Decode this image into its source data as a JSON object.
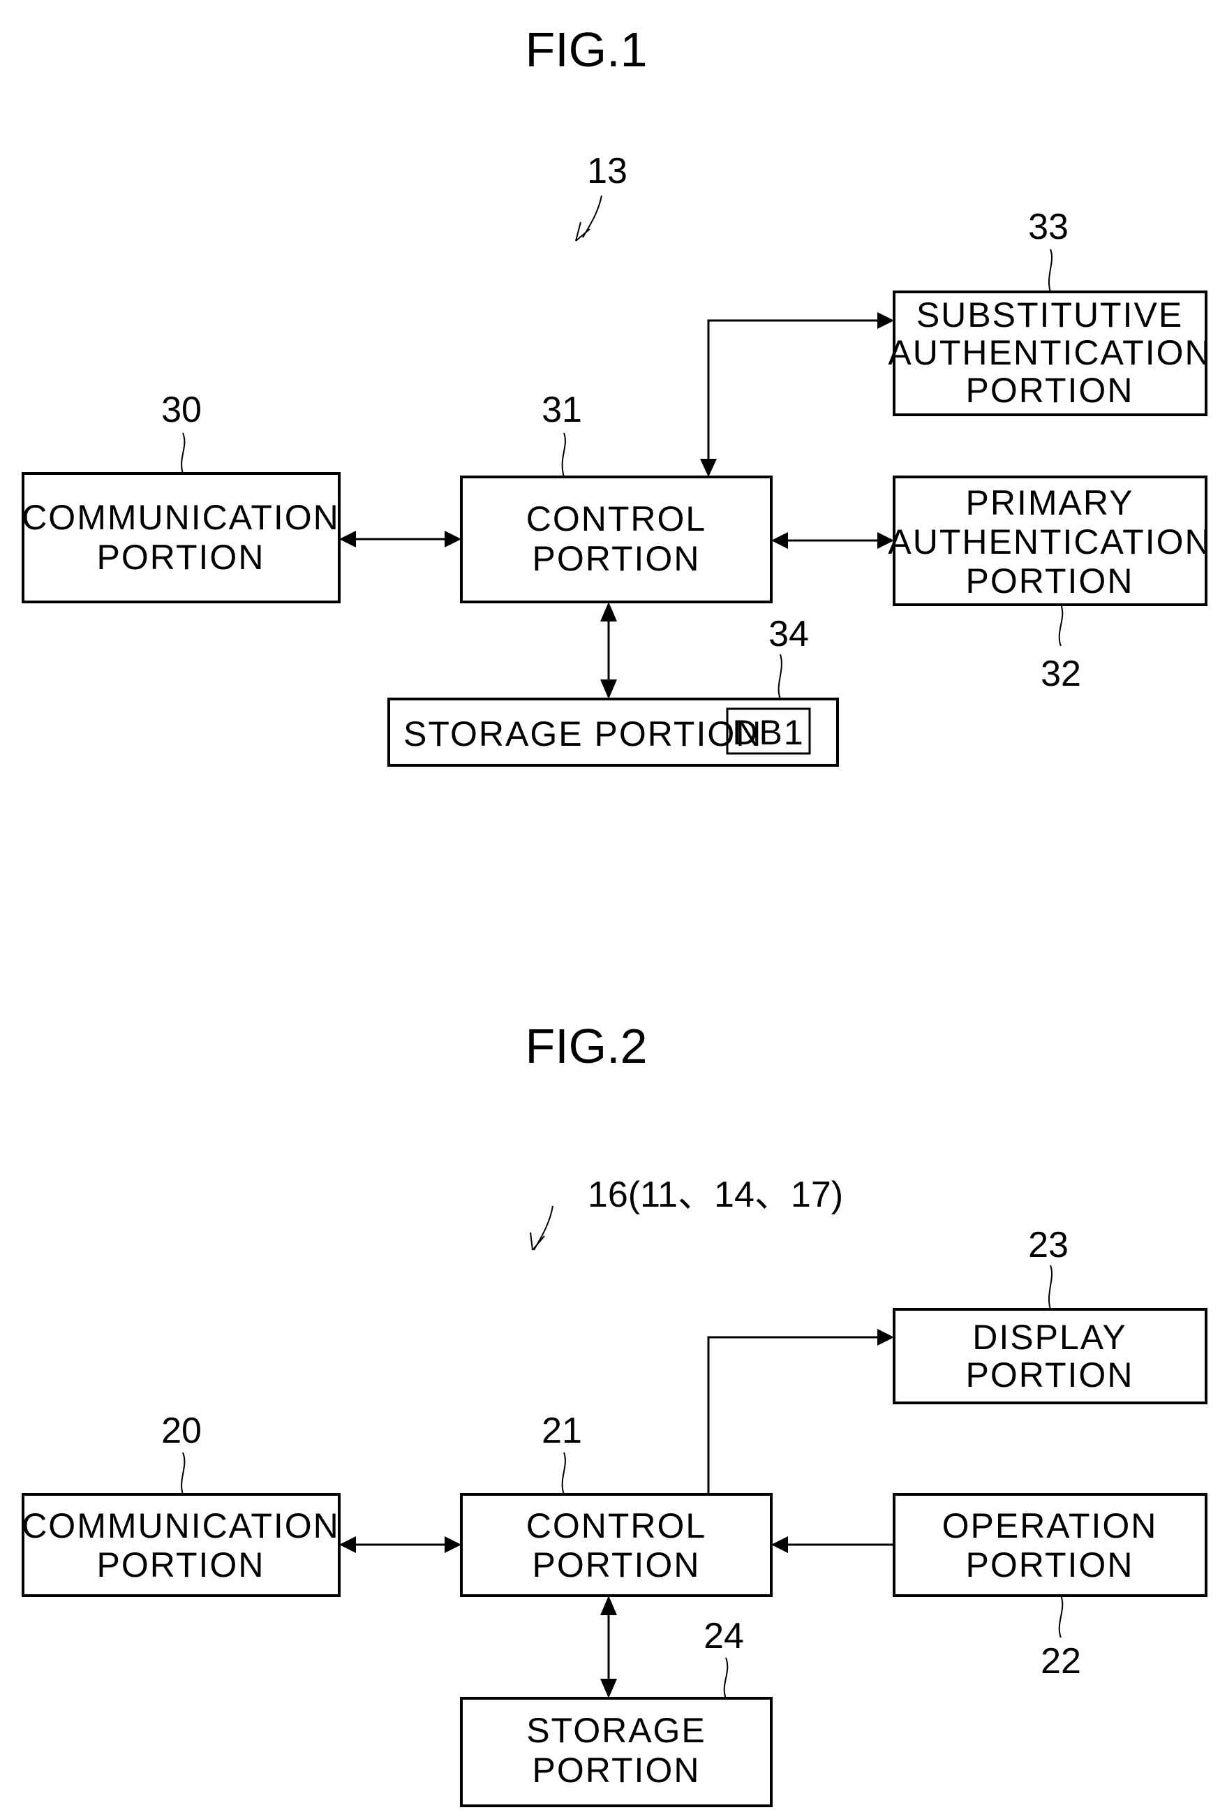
{
  "figures": [
    {
      "title": "FIG.1",
      "device_ref": "13",
      "blocks": {
        "communication": {
          "ref": "30",
          "lines": [
            "COMMUNICATION",
            "PORTION"
          ]
        },
        "control": {
          "ref": "31",
          "lines": [
            "CONTROL",
            "PORTION"
          ]
        },
        "substitutive_auth": {
          "ref": "33",
          "lines": [
            "SUBSTITUTIVE",
            "AUTHENTICATION",
            "PORTION"
          ]
        },
        "primary_auth": {
          "ref": "32",
          "lines": [
            "PRIMARY",
            "AUTHENTICATION",
            "PORTION"
          ]
        },
        "storage": {
          "ref": "34",
          "lines": [
            "STORAGE PORTION"
          ],
          "inner_label": "DB1"
        }
      },
      "connections": [
        {
          "from": "communication",
          "to": "control",
          "direction": "bidirectional"
        },
        {
          "from": "control",
          "to": "substitutive_auth",
          "direction": "bidirectional"
        },
        {
          "from": "control",
          "to": "primary_auth",
          "direction": "bidirectional"
        },
        {
          "from": "control",
          "to": "storage",
          "direction": "bidirectional"
        }
      ]
    },
    {
      "title": "FIG.2",
      "device_ref": "16(11、14、17)",
      "blocks": {
        "communication": {
          "ref": "20",
          "lines": [
            "COMMUNICATION",
            "PORTION"
          ]
        },
        "control": {
          "ref": "21",
          "lines": [
            "CONTROL",
            "PORTION"
          ]
        },
        "display": {
          "ref": "23",
          "lines": [
            "DISPLAY",
            "PORTION"
          ]
        },
        "operation": {
          "ref": "22",
          "lines": [
            "OPERATION",
            "PORTION"
          ]
        },
        "storage": {
          "ref": "24",
          "lines": [
            "STORAGE",
            "PORTION"
          ]
        }
      },
      "connections": [
        {
          "from": "communication",
          "to": "control",
          "direction": "bidirectional"
        },
        {
          "from": "control",
          "to": "display",
          "direction": "forward"
        },
        {
          "from": "operation",
          "to": "control",
          "direction": "forward"
        },
        {
          "from": "control",
          "to": "storage",
          "direction": "bidirectional"
        }
      ]
    }
  ]
}
